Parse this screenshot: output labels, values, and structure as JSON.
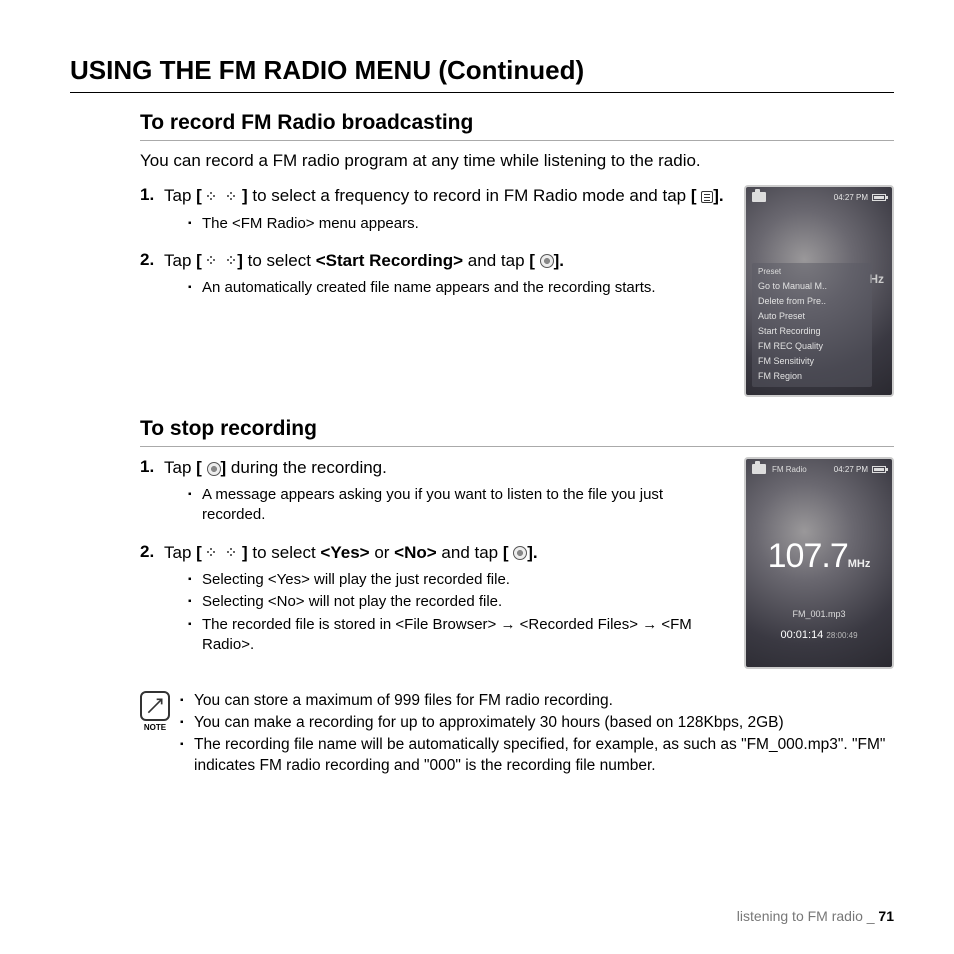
{
  "page_title": "USING THE FM RADIO MENU (Continued)",
  "section1": {
    "heading": "To record FM Radio broadcasting",
    "intro": "You can record a FM radio program at any time while listening to the radio.",
    "steps": [
      {
        "num": "1.",
        "pre": "Tap ",
        "b1": "[ ",
        "b2": " ]",
        "mid": " to select a frequency to record in FM Radio mode and tap ",
        "b3": "[ ",
        "b4": "].",
        "bullets": [
          "The <FM Radio> menu appears."
        ]
      },
      {
        "num": "2.",
        "pre": "Tap ",
        "b1": "[ ",
        "b2": "]",
        "mid": " to select ",
        "bold": "<Start Recording>",
        "mid2": " and tap ",
        "b3": "[ ",
        "b4": "].",
        "bullets": [
          "An automatically created file name appears and the recording starts."
        ]
      }
    ]
  },
  "device1": {
    "time": "04:27 PM",
    "preset_hdr": "Preset",
    "menu": [
      "Go to Manual M..",
      "Delete from Pre..",
      "Auto Preset",
      "Start Recording",
      "FM REC Quality",
      "FM Sensitivity",
      "FM Region"
    ],
    "hz_bg": "Hz"
  },
  "section2": {
    "heading": "To stop recording",
    "steps": [
      {
        "num": "1.",
        "pre": "Tap ",
        "b1": "[ ",
        "b2": "]",
        "post": " during the recording.",
        "bullets": [
          "A message appears asking you if you want to listen to the file you just recorded."
        ]
      },
      {
        "num": "2.",
        "pre": "Tap ",
        "b1": "[ ",
        "b2": " ]",
        "mid": " to select ",
        "bold1": "<Yes>",
        "or": " or ",
        "bold2": "<No>",
        "mid2": " and tap ",
        "b3": "[ ",
        "b4": "].",
        "bullets": [
          "Selecting <Yes> will play the just recorded file.",
          "Selecting <No> will not play the recorded file.",
          "The recorded file is stored in <File Browser> → <Recorded Files> → <FM Radio>."
        ]
      }
    ]
  },
  "device2": {
    "title": "FM Radio",
    "time": "04:27 PM",
    "freq": "107.7",
    "unit": "MHz",
    "file": "FM_001.mp3",
    "elapsed": "00:01:14",
    "remain": "28:00:49"
  },
  "note": {
    "label": "NOTE",
    "items": [
      "You can store a maximum of 999 files for FM radio recording.",
      "You can make a recording for up to approximately 30 hours (based on 128Kbps, 2GB)",
      "The recording file name will be automatically specified, for example, as such as \"FM_000.mp3\". \"FM\" indicates FM radio recording and \"000\" is the recording file number."
    ]
  },
  "footer": {
    "text": "listening to FM radio _ ",
    "page": "71"
  }
}
